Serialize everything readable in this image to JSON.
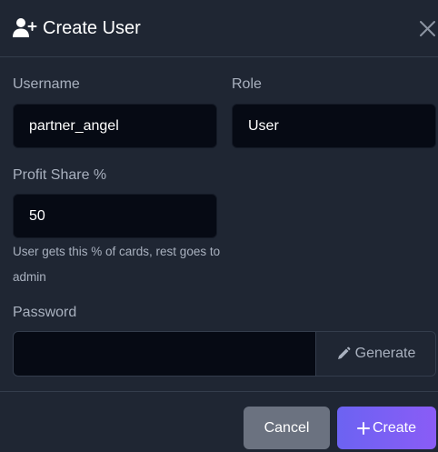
{
  "header": {
    "title": "Create User",
    "icon": "user-plus-icon",
    "close_icon": "close-icon"
  },
  "form": {
    "username": {
      "label": "Username",
      "value": "partner_angel"
    },
    "role": {
      "label": "Role",
      "value": "User"
    },
    "profit_share": {
      "label": "Profit Share %",
      "value": "50",
      "help": "User gets this % of cards, rest goes to admin"
    },
    "password": {
      "label": "Password",
      "value": "",
      "generate_label": "Generate",
      "generate_icon": "pencil-icon"
    }
  },
  "footer": {
    "cancel_label": "Cancel",
    "create_label": "Create",
    "create_icon": "plus-icon"
  },
  "colors": {
    "background": "#1f2633",
    "input_background": "#060a14",
    "label": "#a9b1bf",
    "cancel_button": "#6b7280",
    "create_gradient_start": "#6c63f2",
    "create_gradient_end": "#8a5cf6"
  }
}
